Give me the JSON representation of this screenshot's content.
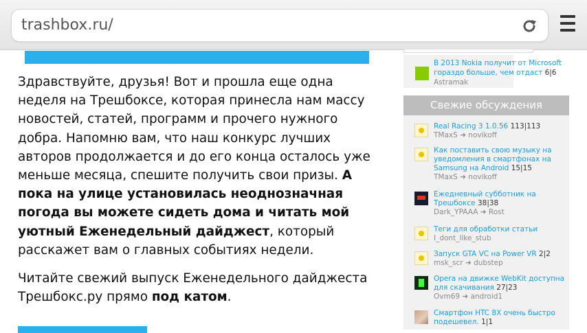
{
  "browser": {
    "url": "trashbox.ru/",
    "reload_icon": "reload-icon",
    "menu_icon": "hamburger-menu-icon"
  },
  "article": {
    "p1_start": "Здравствуйте, друзья! Вот и прошла еще одна неделя на Трешбоксе, которая принесла нам массу новостей, статей, программ и прочего нужного добра. Напомню вам, что наш конкурс лучших авторов продолжается и до его конца осталось уже меньше месяца, спешите получить свои призы. ",
    "p1_bold": "А пока на улице установилась неоднозначная погода вы можете сидеть дома и читать мой уютный Еженедельный дайджест",
    "p1_end": ", который расскажет вам о главных событиях недели.",
    "p2_start": "Читайте свежий выпуск Еженедельного дайджеста Трешбокс.ру прямо ",
    "p2_bold": "под катом",
    "p2_end": "."
  },
  "sidebar": {
    "prev_item": {
      "title": "В 2013 Nokia получит от Microsoft гораздо больше, чем отдаст",
      "count": "6|6",
      "author": "Astramak"
    },
    "discussions_header": "Свежие обсуждения",
    "discussions": [
      {
        "title": "Real Racing 3 1.0.56",
        "count": "113|113",
        "author": "TMaxS",
        "arrow": "➜",
        "last": "novikoff"
      },
      {
        "title": "Как поставить свою музыку на уведомления в смартфонах на Samsung на Android",
        "count": "15|15",
        "author": "TMaxS",
        "arrow": "➜",
        "last": "novikoff"
      },
      {
        "title": "Ежедневный субботник на Трешбоксе",
        "count": "38|38",
        "author": "Dark_YPAAA",
        "arrow": "➜",
        "last": "Rost"
      },
      {
        "title": "Теги для обработки статьи",
        "count": "",
        "author": "I_dont_like_stub",
        "arrow": "",
        "last": ""
      },
      {
        "title": "Запуск GTA VC на Power VR",
        "count": "2|2",
        "author": "msk_scr",
        "arrow": "➜",
        "last": "dubstep"
      },
      {
        "title": "Opera на движке WebKit доступна для скачивания",
        "count": "27|23",
        "author": "Ovm69",
        "arrow": "➜",
        "last": "android1"
      },
      {
        "title": "Смартфон HTC 8X очень быстро подешевел.",
        "count": "1|1",
        "author": "",
        "arrow": "",
        "last": ""
      }
    ]
  },
  "colors": {
    "accent_blue": "#2ab0ea",
    "link_blue": "#1a9be0",
    "sidebar_header": "#bdbdbd"
  }
}
